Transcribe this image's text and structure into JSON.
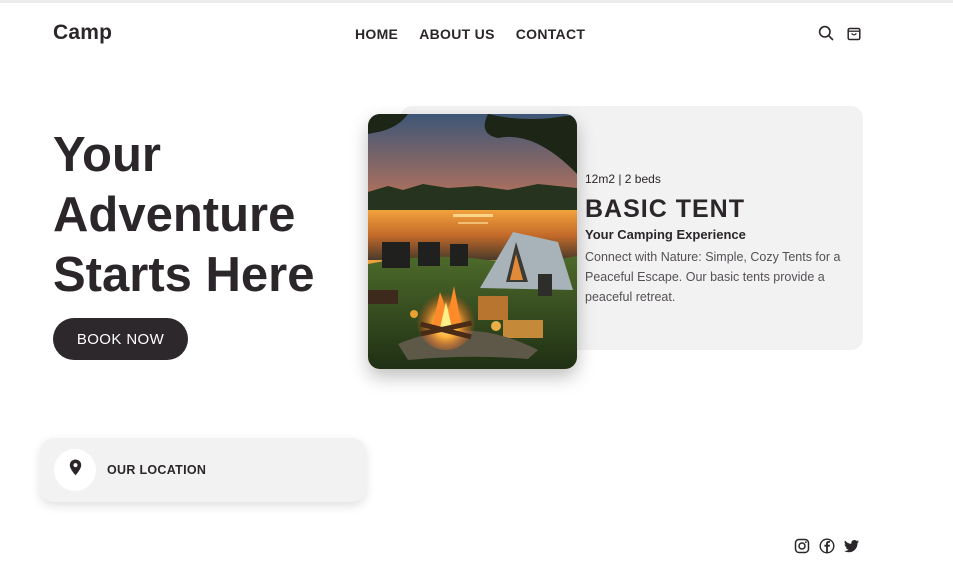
{
  "header": {
    "logo": "Camp",
    "nav": [
      {
        "label": "HOME"
      },
      {
        "label": "ABOUT US"
      },
      {
        "label": "CONTACT"
      }
    ],
    "icons": [
      "search-icon",
      "shopping-bag-icon"
    ]
  },
  "hero": {
    "title_lines": [
      "Your",
      "Adventure",
      "Starts Here"
    ],
    "cta_label": "BOOK NOW"
  },
  "card": {
    "image": "campsite-photo",
    "meta": "12m2 | 2 beds",
    "title": "BASIC TENT",
    "subtitle": "Your Camping Experience",
    "description": "Connect with Nature: Simple, Cozy Tents for a Peaceful Escape. Our basic tents provide a peaceful retreat."
  },
  "location": {
    "icon": "map-pin-icon",
    "label": "OUR LOCATION"
  },
  "social": [
    "instagram-icon",
    "facebook-icon",
    "twitter-icon"
  ],
  "colors": {
    "text": "#2a2629",
    "button": "#2d282b",
    "card_bg": "#f2f2f2",
    "body_text": "#555055"
  }
}
